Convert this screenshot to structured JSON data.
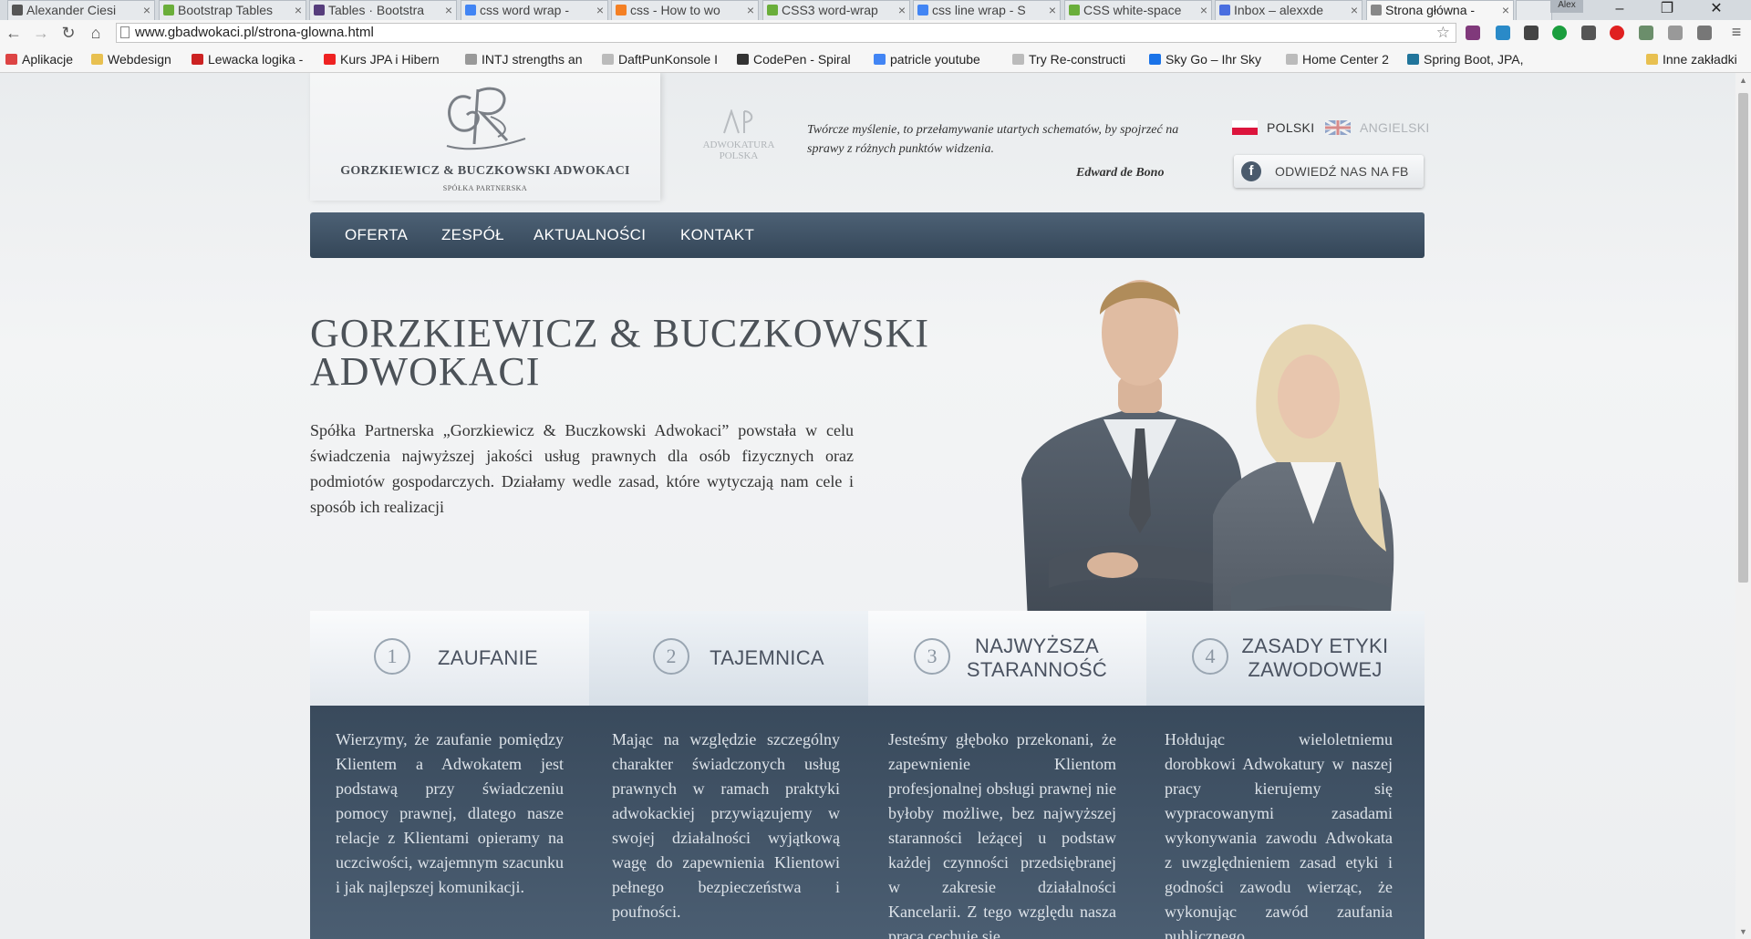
{
  "browser": {
    "tabs": [
      {
        "label": "Alexander Ciesi",
        "color": "#555555"
      },
      {
        "label": "Bootstrap Tables",
        "color": "#6aae3a"
      },
      {
        "label": "Tables · Bootstra",
        "color": "#563d7c"
      },
      {
        "label": "css word wrap -",
        "color": "#4285f4"
      },
      {
        "label": "css - How to wo",
        "color": "#f48024"
      },
      {
        "label": "CSS3 word-wrap",
        "color": "#6aae3a"
      },
      {
        "label": "css line wrap - S",
        "color": "#4285f4"
      },
      {
        "label": "CSS white-space",
        "color": "#6aae3a"
      },
      {
        "label": "Inbox – alexxde",
        "color": "#4a6ee0"
      },
      {
        "label": "Strona główna -",
        "color": "#888888"
      }
    ],
    "user_badge": "Alex",
    "url": "www.gbadwokaci.pl/strona-glowna.html",
    "bookmarks": [
      {
        "label": "Aplikacje",
        "color": "#d44"
      },
      {
        "label": "Webdesign",
        "color": "#e8c050"
      },
      {
        "label": "Lewacka logika -",
        "color": "#c22"
      },
      {
        "label": "Kurs JPA i Hibern",
        "color": "#e22"
      },
      {
        "label": "INTJ strengths an",
        "color": "#999"
      },
      {
        "label": "DaftPunKonsole I",
        "color": "#bbb"
      },
      {
        "label": "CodePen - Spiral",
        "color": "#333"
      },
      {
        "label": "patricle youtube",
        "color": "#4285f4"
      },
      {
        "label": "Try Re-constructi",
        "color": "#bbb"
      },
      {
        "label": "Sky Go – Ihr Sky",
        "color": "#1a73e8"
      },
      {
        "label": "Home Center 2",
        "color": "#bbb"
      },
      {
        "label": "Spring Boot, JPA,",
        "color": "#21759b"
      }
    ],
    "other_bookmarks": "Inne zakładki"
  },
  "site": {
    "logo_name": "GORZKIEWICZ & BUCZKOWSKI ADWOKACI",
    "logo_sub": "SPÓŁKA PARTNERSKA",
    "adwokatura_line1": "ADWOKATURA",
    "adwokatura_line2": "POLSKA",
    "quote": "Twórcze myślenie, to przełamywanie utartych schematów, by spojrzeć na sprawy z różnych punktów widzenia.",
    "quote_author": "Edward de Bono",
    "lang_pl": "POLSKI",
    "lang_en": "ANGIELSKI",
    "fb_button": "ODWIEDŹ NAS NA FB",
    "nav": [
      "OFERTA",
      "ZESPÓŁ",
      "AKTUALNOŚCI",
      "KONTAKT"
    ],
    "hero_title_line1": "GORZKIEWICZ & BUCZKOWSKI",
    "hero_title_line2": "ADWOKACI",
    "hero_text": "Spółka Partnerska „Gorzkiewicz & Buczkowski Adwokaci” powstała w celu świadczenia najwyższej jakości usług prawnych dla osób fizycznych oraz podmiotów gospodarczych. Działamy wedle zasad, które wytyczają nam cele i sposób ich realizacji",
    "features": [
      {
        "num": "1",
        "label": "ZAUFANIE",
        "text": "Wierzymy, że zaufanie pomiędzy Klientem a Adwokatem jest podstawą przy świadczeniu pomocy prawnej, dlatego nasze relacje z Klientami opieramy na uczciwości, wzajemnym szacunku i jak najlepszej komunikacji."
      },
      {
        "num": "2",
        "label": "TAJEMNICA",
        "text": "Mając na względzie szczególny charakter świadczonych usług prawnych w ramach praktyki adwokackiej przywiązujemy w swojej działalności wyjątkową wagę do zapewnienia Klientowi pełnego bezpieczeństwa i poufności."
      },
      {
        "num": "3",
        "label": "NAJWYŻSZA STARANNOŚĆ",
        "text": "Jesteśmy głęboko przekonani, że zapewnienie Klientom profesjonalnej obsługi prawnej nie byłoby możliwe, bez najwyższej staranności leżącej u podstaw każdej czynności przedsiębranej w zakresie działalności Kancelarii. Z tego względu nasza praca cechuje się"
      },
      {
        "num": "4",
        "label": "ZASADY ETYKI ZAWODOWEJ",
        "text": "Hołdując wieloletniemu dorobkowi Adwokatury w naszej pracy kierujemy się wypracowanymi zasadami wykonywania zawodu Adwokata z uwzględnieniem zasad etyki i godności zawodu wierząc, że wykonując zawód zaufania publicznego"
      }
    ]
  },
  "colors": {
    "nav_bg": "#3f5266",
    "panel_bg": "#3e4f61",
    "accent_text": "#4c5258"
  }
}
